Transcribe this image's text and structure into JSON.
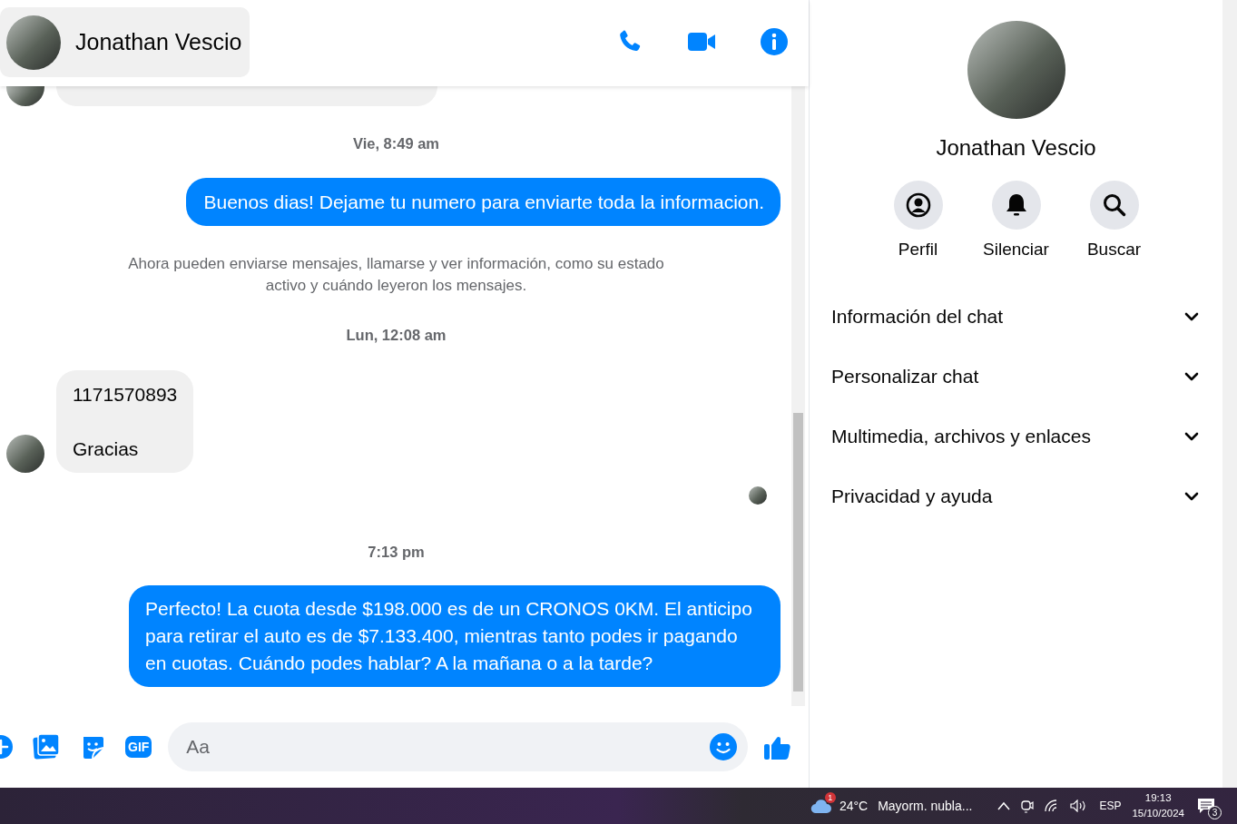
{
  "header": {
    "contact_name": "Jonathan Vescio"
  },
  "messages": [
    {
      "kind": "incoming_partial"
    },
    {
      "kind": "timestamp",
      "text": "Vie, 8:49 am"
    },
    {
      "kind": "outgoing",
      "paragraphs": [
        "Buenos dias! Dejame tu numero para enviarte toda la informacion."
      ]
    },
    {
      "kind": "system",
      "text": "Ahora pueden enviarse mensajes, llamarse y ver información, como su estado activo y cuándo leyeron los mensajes."
    },
    {
      "kind": "timestamp",
      "text": "Lun, 12:08 am"
    },
    {
      "kind": "incoming",
      "paragraphs": [
        "1171570893",
        "Gracias"
      ]
    },
    {
      "kind": "seen"
    },
    {
      "kind": "timestamp",
      "text": "7:13 pm"
    },
    {
      "kind": "outgoing",
      "paragraphs": [
        "Perfecto! La cuota desde $198.000 es de un CRONOS 0KM. El anticipo para retirar el auto es de $7.133.400, mientras tanto podes ir pagando en cuotas. Cuándo podes hablar? A la mañana o a la tarde?"
      ]
    }
  ],
  "composer": {
    "gif_label": "GIF",
    "placeholder": "Aa"
  },
  "profile": {
    "name": "Jonathan Vescio",
    "actions": [
      {
        "kind": "profile",
        "label": "Perfil"
      },
      {
        "kind": "mute",
        "label": "Silenciar"
      },
      {
        "kind": "search",
        "label": "Buscar"
      }
    ],
    "sections": [
      {
        "label": "Información del chat",
        "expanded": false
      },
      {
        "label": "Personalizar chat",
        "expanded": false
      },
      {
        "label": "Multimedia, archivos y enlaces",
        "expanded": false
      },
      {
        "label": "Privacidad y ayuda",
        "expanded": false
      }
    ]
  },
  "taskbar": {
    "weather_badge": "1",
    "temperature": "24°C",
    "weather": "Mayorm. nubla...",
    "language": "ESP",
    "time": "19:13",
    "date": "15/10/2024",
    "notification_count": "3"
  }
}
